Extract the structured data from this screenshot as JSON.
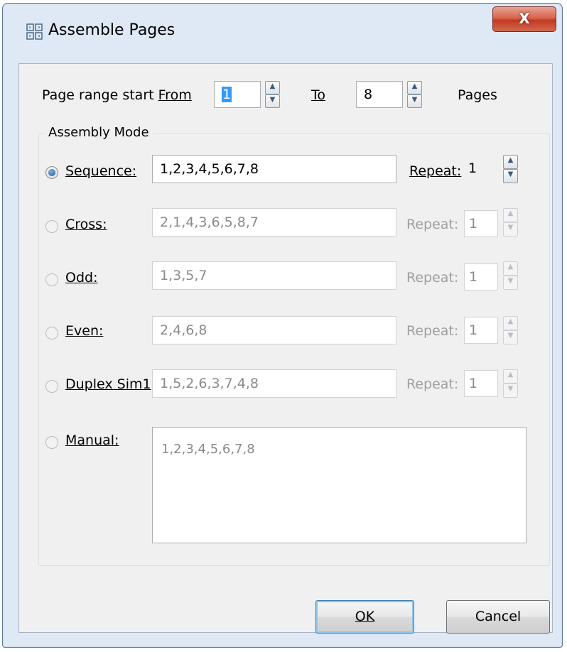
{
  "window": {
    "title": "Assemble Pages",
    "close_label": "X"
  },
  "page_range": {
    "prefix_label": "Page range start ",
    "from_label": "From",
    "from_value": "1",
    "to_label": "To",
    "to_value": "8",
    "suffix_label": "Pages"
  },
  "assembly_mode": {
    "group_title": "Assembly Mode",
    "selected": "sequence",
    "repeat_label": "Repeat:",
    "modes": [
      {
        "key": "sequence",
        "label": "Sequence:",
        "value": "1,2,3,4,5,6,7,8",
        "repeat": "1",
        "enabled": true
      },
      {
        "key": "cross",
        "label": "Cross:",
        "value": "2,1,4,3,6,5,8,7",
        "repeat": "1",
        "enabled": false
      },
      {
        "key": "odd",
        "label": "Odd:",
        "value": "1,3,5,7",
        "repeat": "1",
        "enabled": false
      },
      {
        "key": "even",
        "label": "Even:",
        "value": "2,4,6,8",
        "repeat": "1",
        "enabled": false
      },
      {
        "key": "duplex_sim1",
        "label": "Duplex Sim1",
        "value": "1,5,2,6,3,7,4,8",
        "repeat": "1",
        "enabled": false
      },
      {
        "key": "manual",
        "label": "Manual:",
        "value": "1,2,3,4,5,6,7,8",
        "enabled": false
      }
    ]
  },
  "buttons": {
    "ok": "OK",
    "cancel": "Cancel"
  },
  "icons": {
    "app": "assemble-pages-icon",
    "close": "close-icon",
    "spin_up": "spin-up-icon",
    "spin_down": "spin-down-icon"
  }
}
